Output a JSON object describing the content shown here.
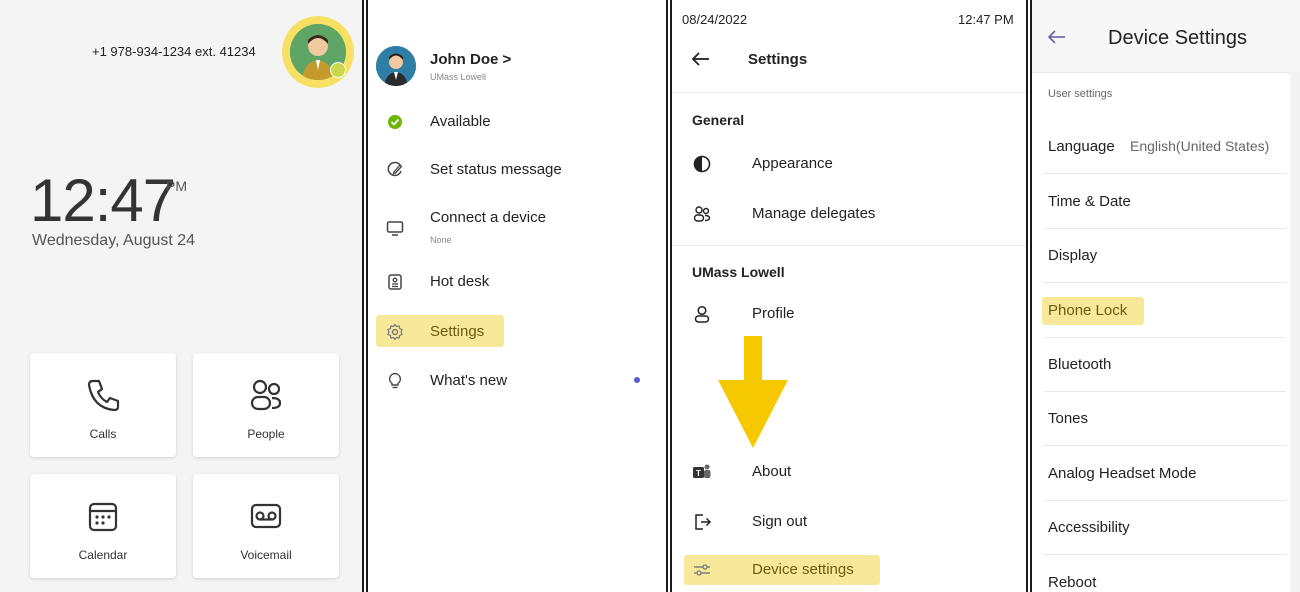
{
  "home": {
    "phone_number": "+1 978-934-1234 ext. 41234",
    "time": "12:47",
    "ampm": "PM",
    "date": "Wednesday, August 24",
    "tiles": [
      {
        "label": "Calls",
        "icon": "phone-icon"
      },
      {
        "label": "People",
        "icon": "people-icon"
      },
      {
        "label": "Calendar",
        "icon": "calendar-icon"
      },
      {
        "label": "Voicemail",
        "icon": "voicemail-icon"
      }
    ]
  },
  "menu": {
    "user_name": "John Doe",
    "user_chevron": ">",
    "user_org": "UMass Lowell",
    "items": [
      {
        "label": "Available",
        "icon": "status-available-icon"
      },
      {
        "label": "Set status message",
        "icon": "pencil-icon"
      },
      {
        "label": "Connect a device",
        "icon": "monitor-icon",
        "sub": "None"
      },
      {
        "label": "Hot desk",
        "icon": "hot-desk-icon"
      },
      {
        "label": "Settings",
        "icon": "gear-icon"
      },
      {
        "label": "What's new",
        "icon": "lightbulb-icon"
      }
    ]
  },
  "settings": {
    "status_date": "08/24/2022",
    "status_time": "12:47 PM",
    "title": "Settings",
    "general_header": "General",
    "org_header": "UMass Lowell",
    "items": {
      "appearance": "Appearance",
      "manage_delegates": "Manage delegates",
      "profile": "Profile",
      "about": "About",
      "sign_out": "Sign out",
      "device_settings": "Device settings"
    }
  },
  "device_settings": {
    "title": "Device Settings",
    "section": "User settings",
    "language_label": "Language",
    "language_value": "English(United States)",
    "rows": [
      "Time & Date",
      "Display",
      "Phone Lock",
      "Bluetooth",
      "Tones",
      "Analog Headset Mode",
      "Accessibility",
      "Reboot"
    ]
  },
  "colors": {
    "highlight": "#f8e99a",
    "arrow": "#f5c800",
    "available": "#6bb700",
    "new_dot": "#5b5fc7",
    "back_arrow_accent": "#6264a7"
  }
}
